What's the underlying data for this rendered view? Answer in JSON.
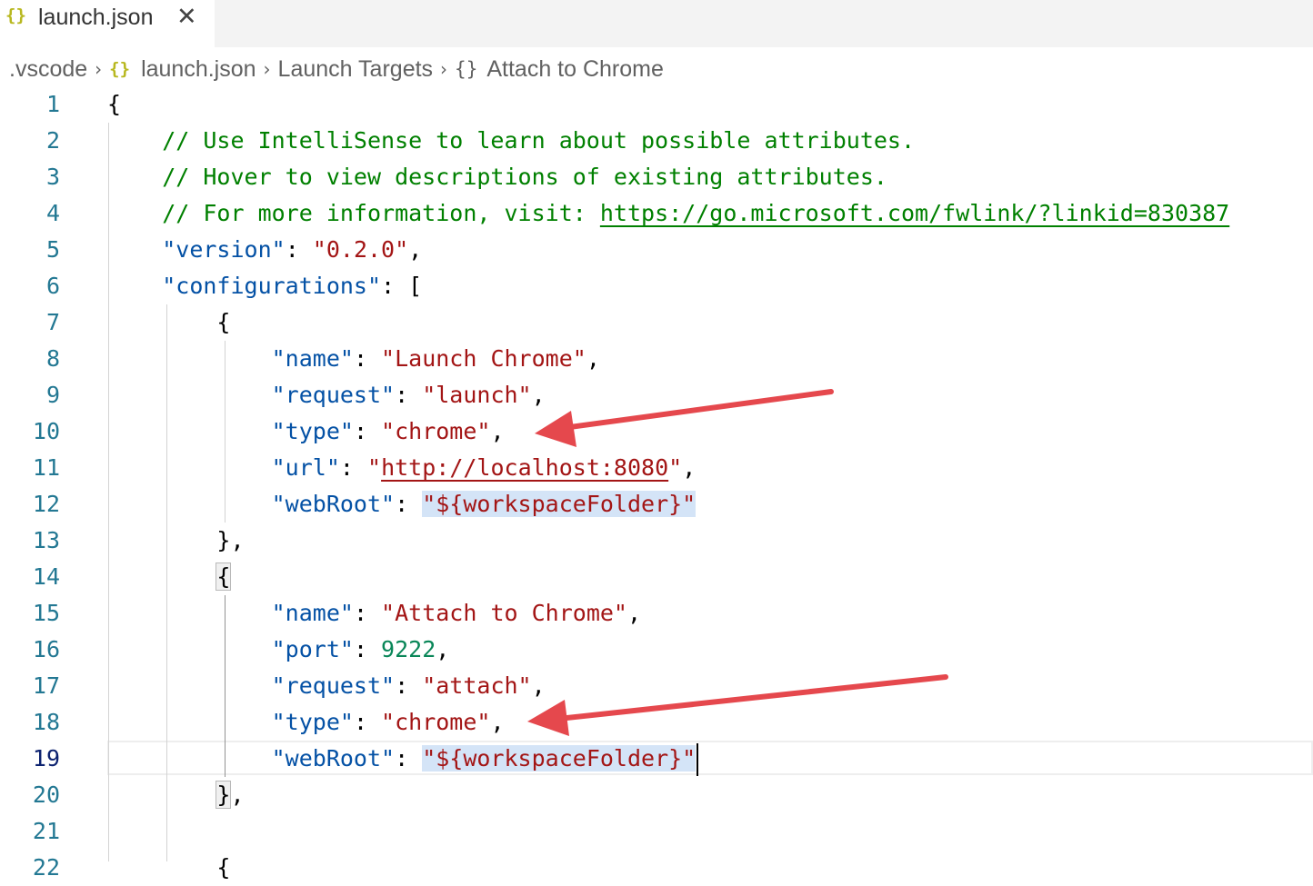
{
  "tab": {
    "icon": "{}",
    "label": "launch.json",
    "close_glyph": "✕"
  },
  "breadcrumb": {
    "items": [
      ".vscode",
      "launch.json",
      "Launch Targets",
      "Attach to Chrome"
    ],
    "json_icon": "{}",
    "object_icon": "{}",
    "separator": "›"
  },
  "editor": {
    "active_line": 19,
    "lines": [
      {
        "n": "1",
        "segs": [
          {
            "t": "{",
            "c": "punc"
          }
        ]
      },
      {
        "n": "2",
        "segs": [
          {
            "t": "    // Use IntelliSense to learn about possible attributes.",
            "c": "cmt"
          }
        ]
      },
      {
        "n": "3",
        "segs": [
          {
            "t": "    // Hover to view descriptions of existing attributes.",
            "c": "cmt"
          }
        ]
      },
      {
        "n": "4",
        "segs": [
          {
            "t": "    // For more information, visit: ",
            "c": "cmt"
          },
          {
            "t": "https://go.microsoft.com/fwlink/?linkid=830387",
            "c": "cmt cmt-link"
          }
        ]
      },
      {
        "n": "5",
        "segs": [
          {
            "t": "    ",
            "c": "punc"
          },
          {
            "t": "\"version\"",
            "c": "key"
          },
          {
            "t": ": ",
            "c": "punc"
          },
          {
            "t": "\"0.2.0\"",
            "c": "str"
          },
          {
            "t": ",",
            "c": "punc"
          }
        ]
      },
      {
        "n": "6",
        "segs": [
          {
            "t": "    ",
            "c": "punc"
          },
          {
            "t": "\"configurations\"",
            "c": "key"
          },
          {
            "t": ": [",
            "c": "punc"
          }
        ]
      },
      {
        "n": "7",
        "segs": [
          {
            "t": "        {",
            "c": "punc"
          }
        ]
      },
      {
        "n": "8",
        "segs": [
          {
            "t": "            ",
            "c": "punc"
          },
          {
            "t": "\"name\"",
            "c": "key"
          },
          {
            "t": ": ",
            "c": "punc"
          },
          {
            "t": "\"Launch Chrome\"",
            "c": "str"
          },
          {
            "t": ",",
            "c": "punc"
          }
        ]
      },
      {
        "n": "9",
        "segs": [
          {
            "t": "            ",
            "c": "punc"
          },
          {
            "t": "\"request\"",
            "c": "key"
          },
          {
            "t": ": ",
            "c": "punc"
          },
          {
            "t": "\"launch\"",
            "c": "str"
          },
          {
            "t": ",",
            "c": "punc"
          }
        ]
      },
      {
        "n": "10",
        "segs": [
          {
            "t": "            ",
            "c": "punc"
          },
          {
            "t": "\"type\"",
            "c": "key"
          },
          {
            "t": ": ",
            "c": "punc"
          },
          {
            "t": "\"chrome\"",
            "c": "str"
          },
          {
            "t": ",",
            "c": "punc"
          }
        ]
      },
      {
        "n": "11",
        "segs": [
          {
            "t": "            ",
            "c": "punc"
          },
          {
            "t": "\"url\"",
            "c": "key"
          },
          {
            "t": ": ",
            "c": "punc"
          },
          {
            "t": "\"",
            "c": "str"
          },
          {
            "t": "http://localhost:8080",
            "c": "str str-link"
          },
          {
            "t": "\"",
            "c": "str"
          },
          {
            "t": ",",
            "c": "punc"
          }
        ]
      },
      {
        "n": "12",
        "segs": [
          {
            "t": "            ",
            "c": "punc"
          },
          {
            "t": "\"webRoot\"",
            "c": "key"
          },
          {
            "t": ": ",
            "c": "punc"
          },
          {
            "t": "\"${workspaceFolder}\"",
            "c": "str sel"
          }
        ]
      },
      {
        "n": "13",
        "segs": [
          {
            "t": "        },",
            "c": "punc"
          }
        ]
      },
      {
        "n": "14",
        "segs": [
          {
            "t": "        ",
            "c": "punc"
          },
          {
            "t": "{",
            "c": "punc bracket-match"
          }
        ]
      },
      {
        "n": "15",
        "segs": [
          {
            "t": "            ",
            "c": "punc"
          },
          {
            "t": "\"name\"",
            "c": "key"
          },
          {
            "t": ": ",
            "c": "punc"
          },
          {
            "t": "\"Attach to Chrome\"",
            "c": "str"
          },
          {
            "t": ",",
            "c": "punc"
          }
        ]
      },
      {
        "n": "16",
        "segs": [
          {
            "t": "            ",
            "c": "punc"
          },
          {
            "t": "\"port\"",
            "c": "key"
          },
          {
            "t": ": ",
            "c": "punc"
          },
          {
            "t": "9222",
            "c": "num"
          },
          {
            "t": ",",
            "c": "punc"
          }
        ]
      },
      {
        "n": "17",
        "segs": [
          {
            "t": "            ",
            "c": "punc"
          },
          {
            "t": "\"request\"",
            "c": "key"
          },
          {
            "t": ": ",
            "c": "punc"
          },
          {
            "t": "\"attach\"",
            "c": "str"
          },
          {
            "t": ",",
            "c": "punc"
          }
        ]
      },
      {
        "n": "18",
        "segs": [
          {
            "t": "            ",
            "c": "punc"
          },
          {
            "t": "\"type\"",
            "c": "key"
          },
          {
            "t": ": ",
            "c": "punc"
          },
          {
            "t": "\"chrome\"",
            "c": "str"
          },
          {
            "t": ",",
            "c": "punc"
          }
        ]
      },
      {
        "n": "19",
        "segs": [
          {
            "t": "            ",
            "c": "punc"
          },
          {
            "t": "\"webRoot\"",
            "c": "key"
          },
          {
            "t": ": ",
            "c": "punc"
          },
          {
            "t": "\"${workspaceFolder}\"",
            "c": "str sel"
          }
        ],
        "cursor": true
      },
      {
        "n": "20",
        "segs": [
          {
            "t": "        ",
            "c": "punc"
          },
          {
            "t": "}",
            "c": "punc bracket-match"
          },
          {
            "t": ",",
            "c": "punc"
          }
        ]
      },
      {
        "n": "21",
        "segs": []
      },
      {
        "n": "22",
        "segs": [
          {
            "t": "        {",
            "c": "punc"
          }
        ]
      }
    ]
  },
  "colors": {
    "key": "#0451a5",
    "string": "#a31515",
    "number": "#098658",
    "comment": "#008000",
    "line_number": "#237893",
    "annotation_arrow": "#e5484d"
  }
}
